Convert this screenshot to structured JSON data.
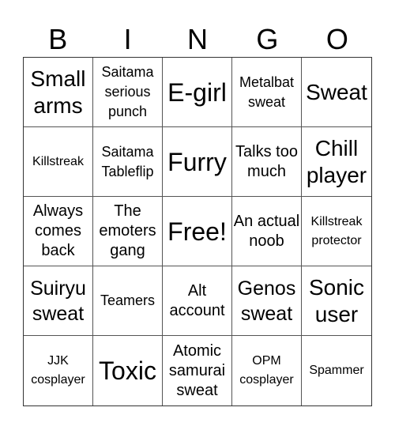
{
  "header": {
    "letters": [
      "B",
      "I",
      "N",
      "G",
      "O"
    ]
  },
  "cells": [
    {
      "text": "Small arms",
      "size": "l"
    },
    {
      "text": "Saitama serious punch",
      "size": "s"
    },
    {
      "text": "E-girl",
      "size": "xl"
    },
    {
      "text": "Metalbat sweat",
      "size": "s"
    },
    {
      "text": "Sweat",
      "size": "l"
    },
    {
      "text": "Killstreak",
      "size": "xs"
    },
    {
      "text": "Saitama Tableflip",
      "size": "s"
    },
    {
      "text": "Furry",
      "size": "xl"
    },
    {
      "text": "Talks too much",
      "size": "n"
    },
    {
      "text": "Chill player",
      "size": "l"
    },
    {
      "text": "Always comes back",
      "size": "n"
    },
    {
      "text": "The emoters gang",
      "size": "n"
    },
    {
      "text": "Free!",
      "size": "xl"
    },
    {
      "text": "An actual noob",
      "size": "n"
    },
    {
      "text": "Killstreak protector",
      "size": "xs"
    },
    {
      "text": "Suiryu sweat",
      "size": "m"
    },
    {
      "text": "Teamers",
      "size": "s"
    },
    {
      "text": "Alt account",
      "size": "n"
    },
    {
      "text": "Genos sweat",
      "size": "m"
    },
    {
      "text": "Sonic user",
      "size": "l"
    },
    {
      "text": "JJK cosplayer",
      "size": "xs"
    },
    {
      "text": "Toxic",
      "size": "xl"
    },
    {
      "text": "Atomic samurai sweat",
      "size": "n"
    },
    {
      "text": "OPM cosplayer",
      "size": "xs"
    },
    {
      "text": "Spammer",
      "size": "xs"
    }
  ]
}
